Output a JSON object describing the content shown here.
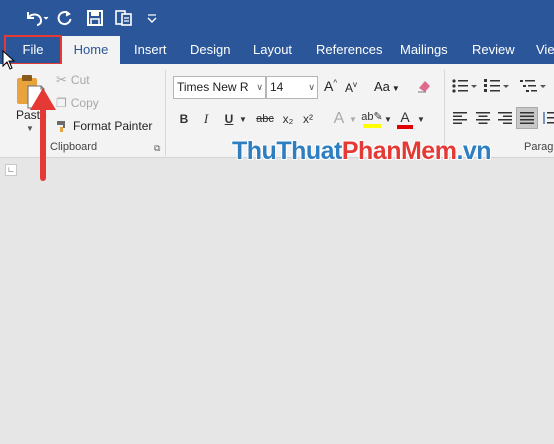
{
  "quick_access": {
    "undo_icon": "undo-icon",
    "redo_icon": "repeat-icon",
    "save_icon": "save-icon",
    "touch_icon": "touch-mode-icon",
    "customize_icon": "customize-qat-icon"
  },
  "tabs": [
    "File",
    "Home",
    "Insert",
    "Design",
    "Layout",
    "References",
    "Mailings",
    "Review",
    "Viev"
  ],
  "clipboard": {
    "paste_label": "Paste",
    "cut_label": "Cut",
    "copy_label": "Copy",
    "format_painter_label": "Format Painter",
    "group_label": "Clipboard"
  },
  "font": {
    "font_name": "Times New R",
    "font_size": "14",
    "bold": "B",
    "italic": "I",
    "underline": "U",
    "strikethrough": "abc",
    "subscript": "x₂",
    "superscript": "x²",
    "grow": "A",
    "shrink": "A",
    "change_case": "Aa",
    "font_color_letter": "A"
  },
  "paragraph": {
    "group_label": "Parag"
  },
  "watermark": {
    "part1": "ThuThuat",
    "part2": "PhanMem",
    "part3": ".vn"
  },
  "colors": {
    "accent": "#2b579a",
    "highlight_annotation": "#e53935",
    "font_color_bar": "#e00000",
    "highlight_bar": "#ffff00"
  }
}
